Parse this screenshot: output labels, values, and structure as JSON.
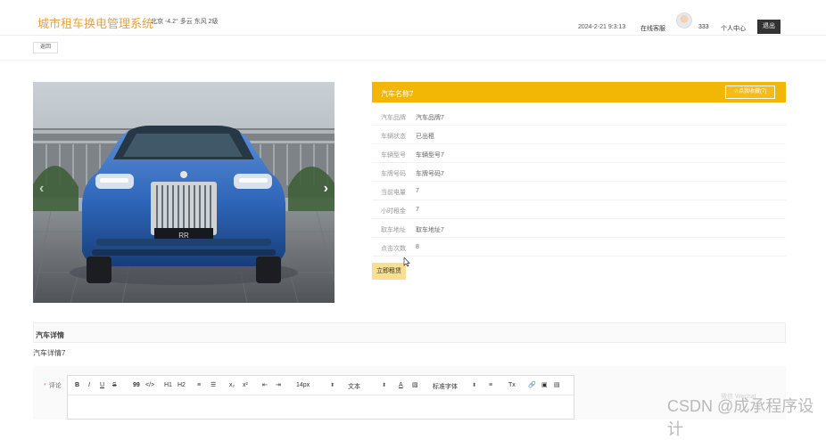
{
  "header": {
    "title": "城市租车换电管理系统",
    "weather": "北京 -4.2° 多云 东风 2级",
    "datetime": "2024-2-21 9:3:13",
    "service": "在线客服",
    "username": "333",
    "user_center": "个人中心",
    "logout": "退出"
  },
  "back_button": "返回",
  "car": {
    "name": "汽车名称7",
    "favorite": "☆点我收藏(7)",
    "fields": [
      {
        "label": "汽车品牌",
        "value": "汽车品牌7"
      },
      {
        "label": "车辆状态",
        "value": "已出租"
      },
      {
        "label": "车辆型号",
        "value": "车辆型号7"
      },
      {
        "label": "车牌号码",
        "value": "车牌号码7"
      },
      {
        "label": "当前电量",
        "value": "7"
      },
      {
        "label": "小时租金",
        "value": "7"
      },
      {
        "label": "取车地址",
        "value": "取车地址7"
      },
      {
        "label": "点击次数",
        "value": "8"
      }
    ],
    "rent_button": "立即租赁"
  },
  "details": {
    "title": "汽车详情",
    "content": "汽车详情7"
  },
  "comment": {
    "label": "评论",
    "required": "*",
    "toolbar": {
      "bold": "B",
      "italic": "I",
      "underline": "U",
      "strike": "S",
      "quote": "99",
      "code": "</>",
      "h1": "H1",
      "h2": "H2",
      "ordered_list": "≡",
      "bullet_list": "☰",
      "subscript": "x₂",
      "superscript": "x²",
      "outdent": "⇤",
      "indent": "⇥",
      "font_size": "14px",
      "text_type": "文本",
      "text_color": "A",
      "background_color": "▧",
      "font_family": "标准字体",
      "align": "≡",
      "clear_format": "Tx",
      "link": "🔗",
      "image": "▣",
      "video": "▤"
    }
  },
  "watermark": "CSDN @成承程序设计",
  "small_watermark": "微信 Wechat",
  "colors": {
    "title": "#e8a33c",
    "accent": "#f2b705",
    "rent_button": "#f8df91",
    "logout": "#333333"
  }
}
